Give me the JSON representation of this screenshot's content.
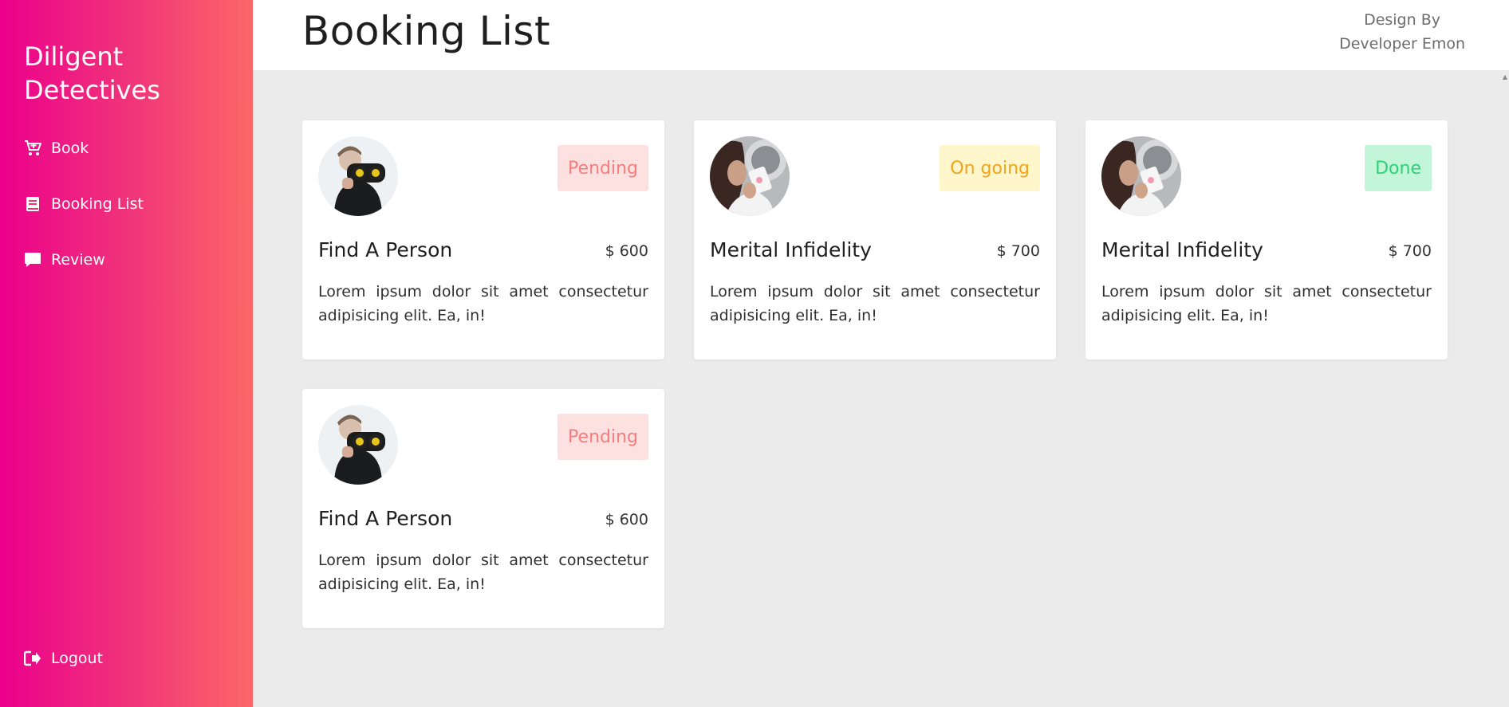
{
  "sidebar": {
    "brand": "Diligent Detectives",
    "items": [
      {
        "label": "Book",
        "icon": "cart-plus-icon"
      },
      {
        "label": "Booking List",
        "icon": "book-icon"
      },
      {
        "label": "Review",
        "icon": "comment-icon"
      }
    ],
    "logout": {
      "label": "Logout",
      "icon": "sign-out-icon"
    }
  },
  "header": {
    "title": "Booking List",
    "credit_line1": "Design By",
    "credit_line2": "Developer Emon"
  },
  "bookings": [
    {
      "title": "Find A Person",
      "price": "$ 600",
      "status": "Pending",
      "description": "Lorem ipsum dolor sit amet consectetur adipisicing elit. Ea, in!",
      "image": "detective-binoculars"
    },
    {
      "title": "Merital Infidelity",
      "price": "$ 700",
      "status": "On going",
      "description": "Lorem ipsum dolor sit amet consectetur adipisicing elit. Ea, in!",
      "image": "woman-with-card"
    },
    {
      "title": "Merital Infidelity",
      "price": "$ 700",
      "status": "Done",
      "description": "Lorem ipsum dolor sit amet consectetur adipisicing elit. Ea, in!",
      "image": "woman-with-card"
    },
    {
      "title": "Find A Person",
      "price": "$ 600",
      "status": "Pending",
      "description": "Lorem ipsum dolor sit amet consectetur adipisicing elit. Ea, in!",
      "image": "detective-binoculars"
    }
  ],
  "colors": {
    "sidebar_gradient_start": "#ec008c",
    "sidebar_gradient_end": "#fc6767",
    "pending": "#f47d7d",
    "ongoing": "#f0a41c",
    "done": "#2fd079"
  }
}
